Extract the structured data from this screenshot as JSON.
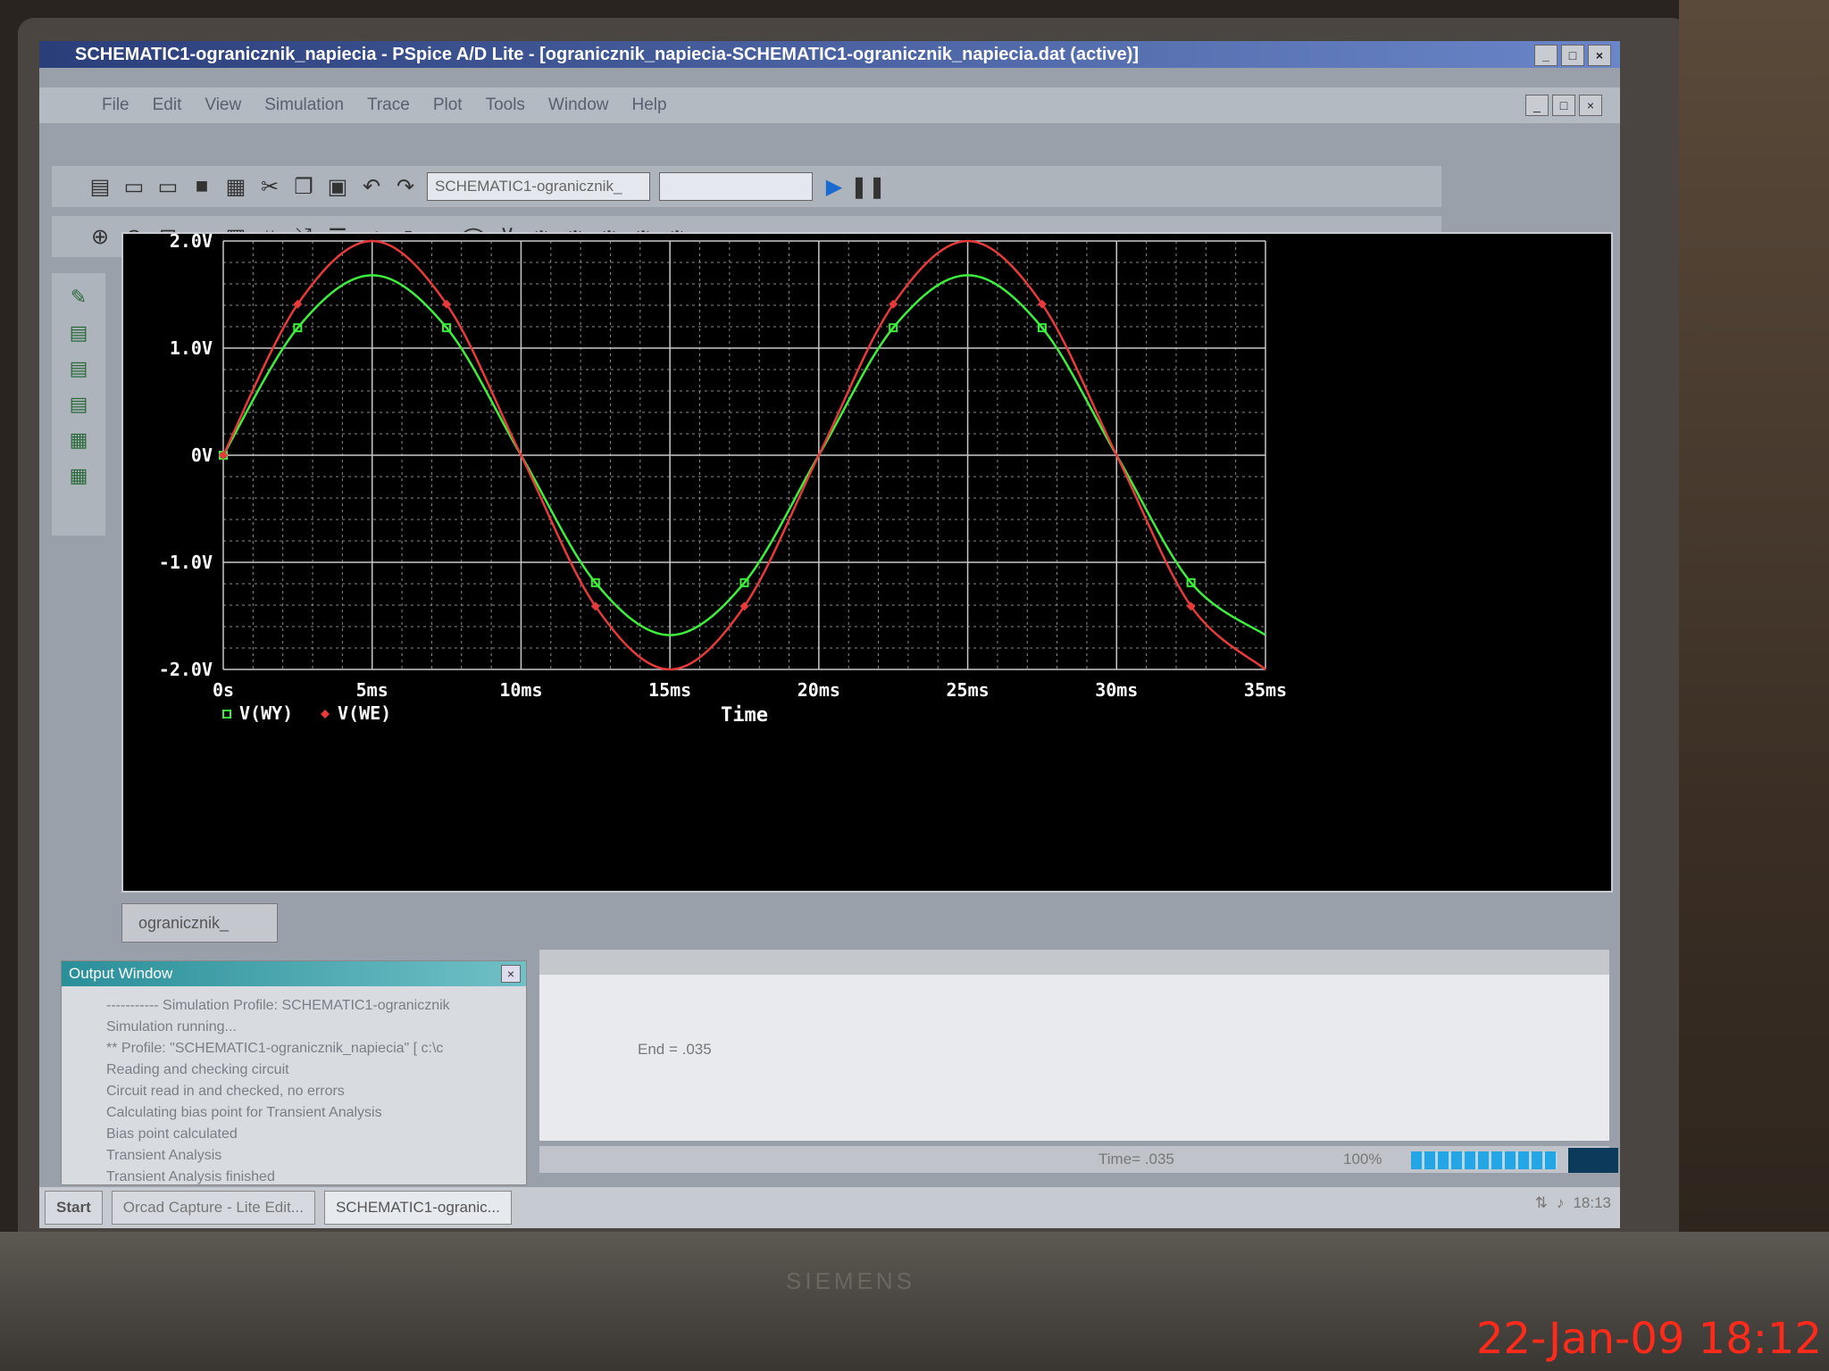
{
  "window": {
    "title": "SCHEMATIC1-ogranicznik_napiecia - PSpice A/D Lite - [ogranicznik_napiecia-SCHEMATIC1-ogranicznik_napiecia.dat (active)]"
  },
  "menu": [
    "File",
    "Edit",
    "View",
    "Simulation",
    "Trace",
    "Plot",
    "Tools",
    "Window",
    "Help"
  ],
  "toolbar": {
    "profile_value": "SCHEMATIC1-ogranicznik_",
    "run_icon": "play-icon",
    "pause_icon": "pause-icon"
  },
  "doc_tab": {
    "label": "ogranicznik_"
  },
  "chart_data": {
    "type": "line",
    "xlabel": "Time",
    "x_ticks": [
      "0s",
      "5ms",
      "10ms",
      "15ms",
      "20ms",
      "25ms",
      "30ms",
      "35ms"
    ],
    "y_ticks": [
      "2.0V",
      "1.0V",
      "0V",
      "-1.0V",
      "-2.0V"
    ],
    "xlim": [
      0,
      35
    ],
    "ylim": [
      -2.0,
      2.0
    ],
    "grid": true,
    "legend": "bottom-left",
    "colors": {
      "background": "#000000",
      "grid": "#8a8a8a",
      "text": "#ffffff"
    },
    "series": [
      {
        "name": "V(WY)",
        "color": "#3cf03c",
        "marker": "square",
        "x": [
          0,
          2.5,
          5,
          7.5,
          10,
          12.5,
          15,
          17.5,
          20,
          22.5,
          25,
          27.5,
          30,
          32.5,
          35
        ],
        "y": [
          0,
          1.19,
          1.68,
          1.19,
          0,
          -1.19,
          -1.68,
          -1.19,
          0,
          1.19,
          1.68,
          1.19,
          0,
          -1.19,
          -1.68
        ]
      },
      {
        "name": "V(WE)",
        "color": "#e83a3a",
        "marker": "diamond",
        "x": [
          0,
          2.5,
          5,
          7.5,
          10,
          12.5,
          15,
          17.5,
          20,
          22.5,
          25,
          27.5,
          30,
          32.5,
          35
        ],
        "y": [
          0,
          1.41,
          2.0,
          1.41,
          0,
          -1.41,
          -2.0,
          -1.41,
          0,
          1.41,
          2.0,
          1.41,
          0,
          -1.41,
          -2.0
        ]
      }
    ]
  },
  "output_window": {
    "title": "Output Window",
    "lines": [
      "----------- Simulation Profile: SCHEMATIC1-ogranicznik",
      "Simulation running...",
      "** Profile: \"SCHEMATIC1-ogranicznik_napiecia\" [ c:\\c",
      "Reading and checking circuit",
      "Circuit read in and checked, no errors",
      "Calculating bias point for Transient Analysis",
      "Bias point calculated",
      "Transient Analysis",
      "Transient Analysis finished"
    ]
  },
  "status": {
    "end": "End = .035",
    "time": "Time= .035",
    "zoom": "100%",
    "progress": 1.0
  },
  "taskbar": {
    "start": "Start",
    "tasks": [
      "Orcad Capture - Lite Edit...",
      "SCHEMATIC1-ogranic..."
    ],
    "clock": "18:13"
  },
  "photo_stamp": "22-Jan-09 18:12",
  "monitor_brand": "SIEMENS"
}
